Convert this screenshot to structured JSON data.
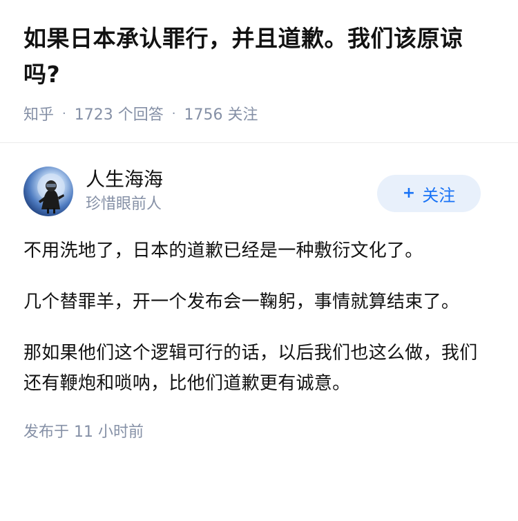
{
  "question": {
    "title": "如果日本承认罪行，并且道歉。我们该原谅吗?",
    "source": "知乎",
    "answers_count": "1723 个回答",
    "followers_count": "1756 关注"
  },
  "author": {
    "name": "人生海海",
    "bio": "珍惜眼前人",
    "avatar_icon": "astronaut-moon-avatar"
  },
  "follow_button": {
    "label": "关注",
    "icon": "plus-icon",
    "color": "#1772f6",
    "background": "#e8f0fb"
  },
  "answer": {
    "paragraphs": [
      "不用洗地了，日本的道歉已经是一种敷衍文化了。",
      "几个替罪羊，开一个发布会一鞠躬，事情就算结束了。",
      "那如果他们这个逻辑可行的话，以后我们也这么做，我们还有鞭炮和唢呐，比他们道歉更有诚意。"
    ],
    "published": "发布于 11 小时前"
  }
}
